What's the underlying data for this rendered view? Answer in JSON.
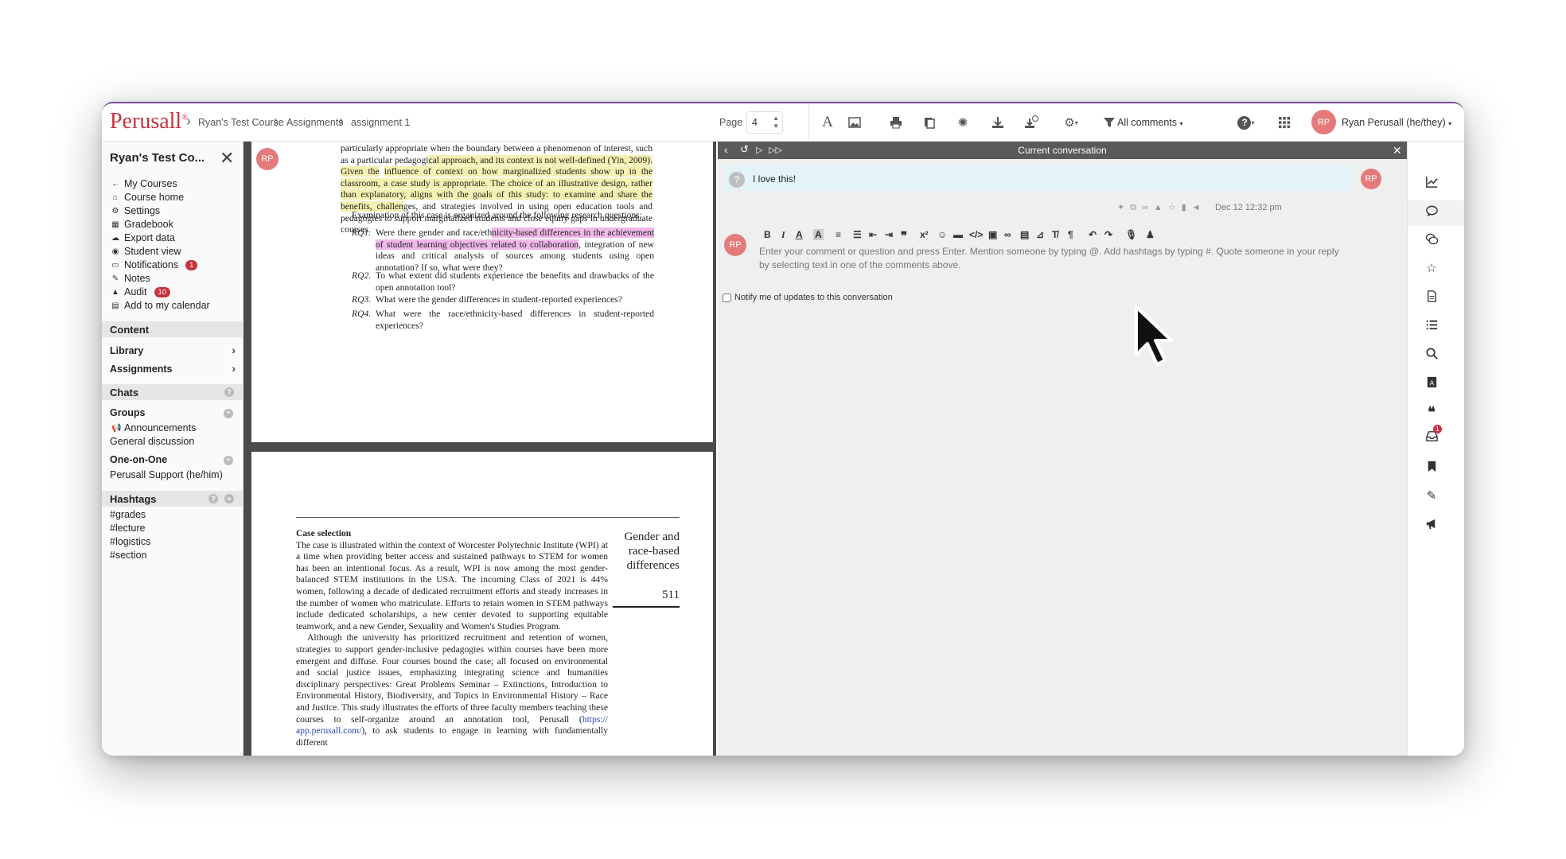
{
  "app": {
    "logo": "Perusall",
    "logo_mark": "®"
  },
  "breadcrumb": [
    "Ryan's Test Course",
    "Assignments",
    "assignment 1"
  ],
  "page": {
    "label": "Page",
    "value": "4"
  },
  "toolbar": {
    "all_comments": "All comments",
    "user_initials": "RP",
    "user_name": "Ryan Perusall (he/they)"
  },
  "sidebar": {
    "course_title": "Ryan's Test Co...",
    "nav": [
      {
        "label": "My Courses",
        "icon": "arrow-left-icon"
      },
      {
        "label": "Course home",
        "icon": "home-icon"
      },
      {
        "label": "Settings",
        "icon": "gear-icon"
      },
      {
        "label": "Gradebook",
        "icon": "table-icon"
      },
      {
        "label": "Export data",
        "icon": "cloud-download-icon"
      },
      {
        "label": "Student view",
        "icon": "eye-icon"
      },
      {
        "label": "Notifications",
        "icon": "inbox-icon",
        "badge": "1"
      },
      {
        "label": "Notes",
        "icon": "pencil-icon"
      },
      {
        "label": "Audit",
        "icon": "warning-icon",
        "badge": "10"
      },
      {
        "label": "Add to my calendar",
        "icon": "calendar-icon"
      }
    ],
    "content_header": "Content",
    "library": "Library",
    "assignments": "Assignments",
    "chats_header": "Chats",
    "groups": "Groups",
    "announcements": "Announcements",
    "general_discussion": "General discussion",
    "one_on_one": "One-on-One",
    "support": "Perusall Support (he/him)",
    "hashtags_header": "Hashtags",
    "hashtags": [
      "#grades",
      "#lecture",
      "#logistics",
      "#section"
    ]
  },
  "document": {
    "avatar": "RP",
    "p1_line1": "particularly appropriate when the boundary between a phenomenon of interest, such as a",
    "p1_line2a": "particular pedagogi",
    "p1_line2b": "cal approach, and its context is not well-defined (Yin, 2009). Given the",
    "p1_hl": "influence of context on how marginalized students show up in the classroom, a case study is appropriate. The choice of an illustrative design, rather than explanatory, aligns with the goals of this study: to examine and share the benefits, challen",
    "p1_rest": "ges, and strategies involved in using open education tools and pedagogies to support marginalized students and close equity gaps in undergraduate courses.",
    "p1_exam": "Examination of this case is organized around the following research questions:",
    "rq": [
      {
        "label": "RQ1.",
        "pre": "Were there gender and race/eth",
        "hl": "nicity-based differences in the achievement of student learning objectives related to collaboration",
        "post": ", integration of new ideas and critical analysis of sources among students using open annotation? If so, what were they?"
      },
      {
        "label": "RQ2.",
        "pre": "To what extent did students experience the benefits and drawbacks of the open annotation tool?",
        "hl": "",
        "post": ""
      },
      {
        "label": "RQ3.",
        "pre": "What were the gender differences in student-reported experiences?",
        "hl": "",
        "post": ""
      },
      {
        "label": "RQ4.",
        "pre": "What were the race/ethnicity-based differences in student-reported experiences?",
        "hl": "",
        "post": ""
      }
    ],
    "p2_heading": "Case selection",
    "p2_body1": "The case is illustrated within the context of Worcester Polytechnic Institute (WPI) at a time when providing better access and sustained pathways to STEM for women has been an intentional focus. As a result, WPI is now among the most gender-balanced STEM institutions in the USA. The incoming Class of 2021 is 44% women, following a decade of dedicated recruitment efforts and steady increases in the number of women who matriculate. Efforts to retain women in STEM pathways include dedicated scholarships, a new center devoted to supporting equitable teamwork, and a new Gender, Sexuality and Women's Studies Program.",
    "p2_body2": "Although the university has prioritized recruitment and retention of women, strategies to support gender-inclusive pedagogies within courses have been more emergent and diffuse. Four courses bound the case; all focused on environmental and social justice issues, emphasizing integrating science and humanities disciplinary perspectives: Great Problems Seminar – Extinctions, Introduction to Environmental History, Biodiversity, and Topics in Environmental History – Race and Justice. This study illustrates the efforts of three faculty members teaching these courses to self-organize around an annotation tool, Perusall (",
    "p2_link": "https:// app.perusall.com/",
    "p2_end": "), to ask students to engage in learning with fundamentally different",
    "running_head": "Gender and race-based differences",
    "page_number": "511"
  },
  "conversation": {
    "title": "Current conversation",
    "comment": "I love this!",
    "commenter_initials": "RP",
    "timestamp": "Dec 12 12:32 pm",
    "reply_avatar": "RP",
    "input_placeholder": "Enter your comment or question and press Enter. Mention someone by typing @. Add hashtags by typing #. Quote someone in your reply by selecting text in one of the comments above.",
    "notify_label": "Notify me of updates to this conversation",
    "notify_checked": false
  },
  "rail": {
    "inbox_badge": "1"
  },
  "colors": {
    "brand": "#c8323e",
    "avatar": "#e57a7a",
    "highlight_yellow": "#f3f0b0",
    "highlight_pink": "#f1b8e9",
    "panel_bar": "#5a5a5a"
  }
}
